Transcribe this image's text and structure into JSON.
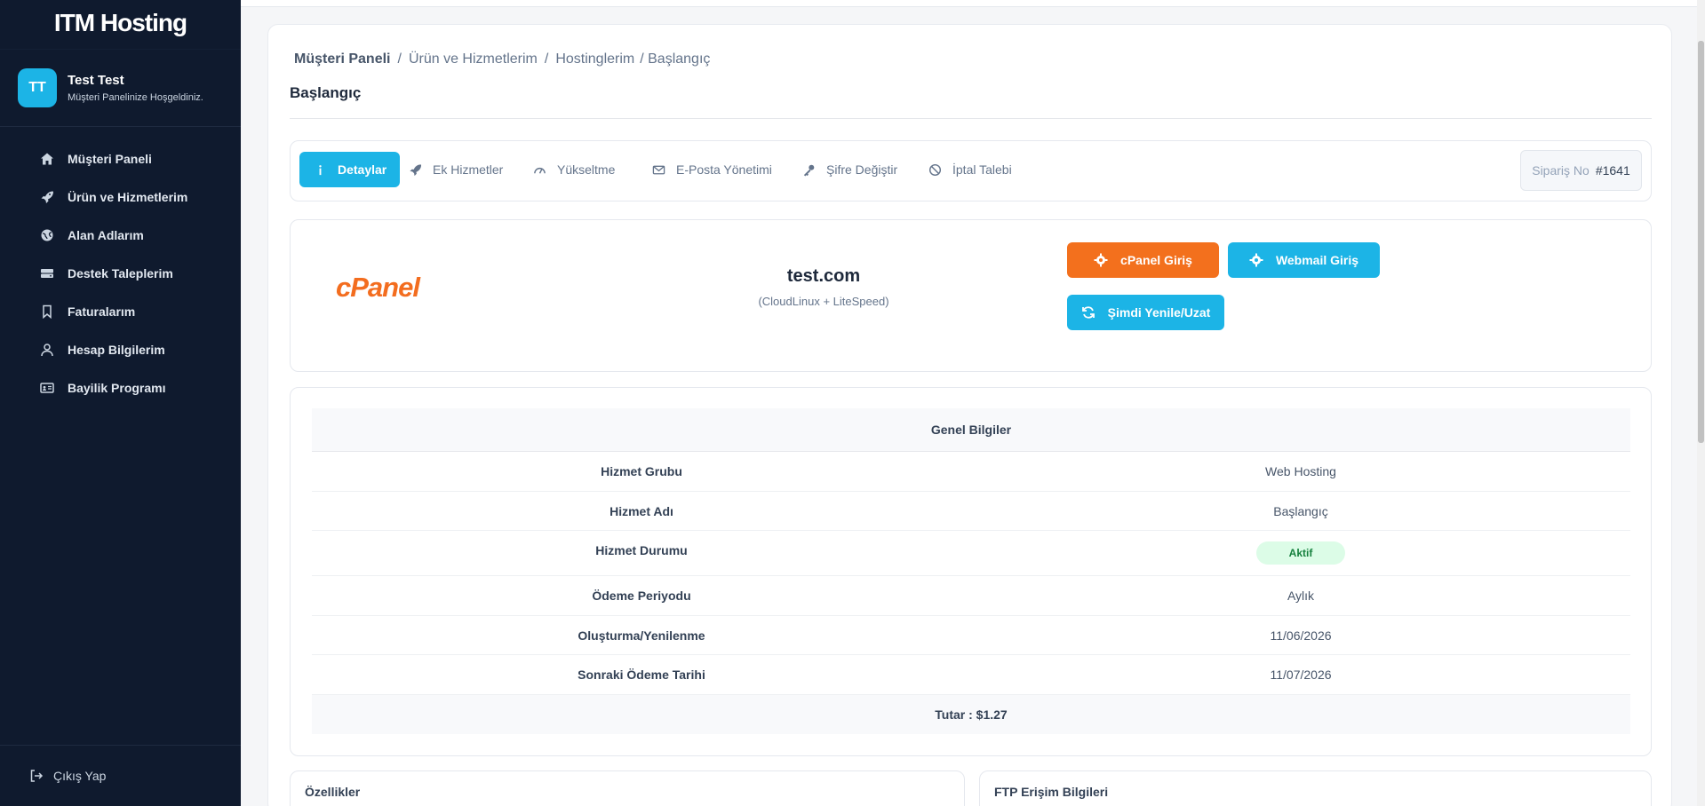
{
  "brand": {
    "logo_text": "ITM Hosting"
  },
  "user": {
    "initials": "TT",
    "name": "Test Test",
    "subtitle": "Müşteri Panelinize Hoşgeldiniz."
  },
  "sidebar": {
    "items": [
      {
        "label": "Müşteri Paneli",
        "icon": "home-icon"
      },
      {
        "label": "Ürün ve Hizmetlerim",
        "icon": "rocket-icon"
      },
      {
        "label": "Alan Adlarım",
        "icon": "globe-icon"
      },
      {
        "label": "Destek Taleplerim",
        "icon": "server-icon"
      },
      {
        "label": "Faturalarım",
        "icon": "bookmark-icon"
      },
      {
        "label": "Hesap Bilgilerim",
        "icon": "user-icon"
      },
      {
        "label": "Bayilik Programı",
        "icon": "id-card-icon"
      }
    ],
    "logout": "Çıkış Yap"
  },
  "breadcrumb": [
    "Müşteri Paneli",
    "Ürün ve Hizmetlerim",
    "Hostinglerim",
    "/ Başlangıç"
  ],
  "page_title": "Başlangıç",
  "tabs": [
    {
      "label": "Detaylar",
      "icon": "info-icon",
      "active": true
    },
    {
      "label": "Ek Hizmetler",
      "icon": "rocket-icon"
    },
    {
      "label": "Yükseltme",
      "icon": "gauge-icon"
    },
    {
      "label": "E-Posta Yönetimi",
      "icon": "envelope-icon"
    },
    {
      "label": "Şifre Değiştir",
      "icon": "key-icon"
    },
    {
      "label": "İptal Talebi",
      "icon": "ban-icon"
    }
  ],
  "order": {
    "label": "Sipariş No",
    "value": "#1641"
  },
  "service": {
    "logo_text": "cPanel",
    "domain": "test.com",
    "platform": "(CloudLinux + LiteSpeed)",
    "buttons": {
      "cpanel": "cPanel Giriş",
      "webmail": "Webmail Giriş",
      "renew": "Şimdi Yenile/Uzat"
    }
  },
  "info": {
    "heading": "Genel Bilgiler",
    "rows": [
      {
        "key": "Hizmet Grubu",
        "value": "Web Hosting"
      },
      {
        "key": "Hizmet Adı",
        "value": "Başlangıç"
      },
      {
        "key": "Hizmet Durumu",
        "value": "Aktif"
      },
      {
        "key": "Ödeme Periyodu",
        "value": "Aylık"
      },
      {
        "key": "Oluşturma/Yenilenme",
        "value": "11/06/2026"
      },
      {
        "key": "Sonraki Ödeme Tarihi",
        "value": "11/07/2026"
      }
    ],
    "total": "Tutar : $1.27"
  },
  "cards": {
    "features": "Özellikler",
    "ftp": "FTP Erişim Bilgileri"
  },
  "colors": {
    "sidebar_bg": "#0f1a2e",
    "accent": "#1cb4e6",
    "cpanel_orange": "#f3701d",
    "active_badge": "#dcfce7"
  }
}
